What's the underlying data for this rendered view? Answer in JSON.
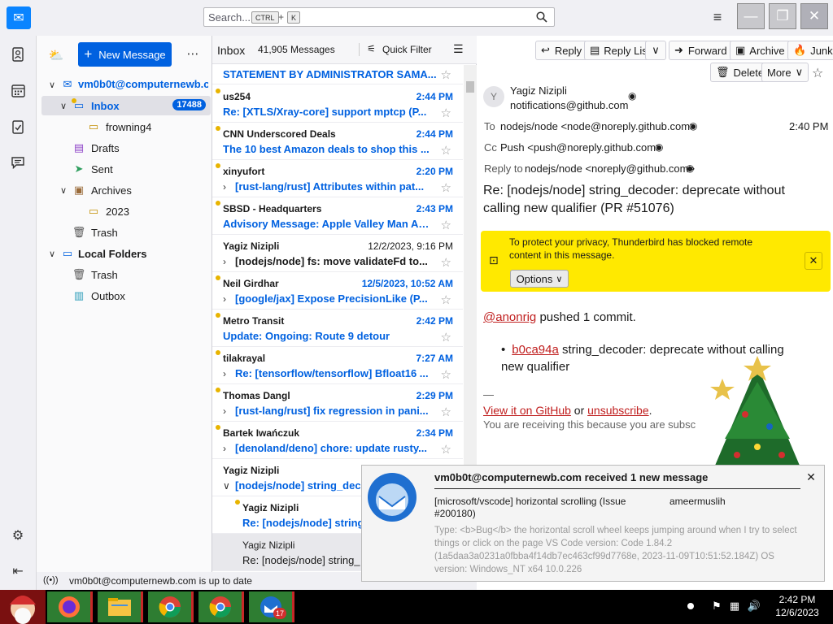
{
  "titlebar": {
    "search_placeholder": "Search...",
    "search_shortcut_ctrl": "CTRL",
    "search_shortcut_plus": "+",
    "search_shortcut_key": "K"
  },
  "folders": {
    "new_message": "New Message",
    "account": "vm0b0t@computernewb.com",
    "inbox": "Inbox",
    "inbox_count": "17488",
    "frowning": "frowning4",
    "drafts": "Drafts",
    "sent": "Sent",
    "archives": "Archives",
    "archives_2023": "2023",
    "trash": "Trash",
    "local_folders": "Local Folders",
    "local_trash": "Trash",
    "outbox": "Outbox"
  },
  "status": {
    "text": "vm0b0t@computernewb.com is up to date"
  },
  "thread": {
    "folder_name": "Inbox",
    "count": "41,905 Messages",
    "quick_filter": "Quick Filter",
    "pinned_subject": "STATEMENT BY ADMINISTRATOR SAMA...",
    "messages": [
      {
        "sender": "us254",
        "date": "2:44 PM",
        "subject": "Re: [XTLS/Xray-core] support mptcp (P..."
      },
      {
        "sender": "CNN Underscored Deals",
        "date": "2:44 PM",
        "subject": "The 10 best Amazon deals to shop this ..."
      },
      {
        "sender": "xinyufort",
        "date": "2:20 PM",
        "subject": "[rust-lang/rust] Attributes within pat..."
      },
      {
        "sender": "SBSD - Headquarters",
        "date": "2:43 PM",
        "subject": "Advisory Message: Apple Valley Man Ar..."
      },
      {
        "sender": "Yagiz Nizipli",
        "date": "12/2/2023, 9:16 PM",
        "subject": "[nodejs/node] fs: move validateFd to..."
      },
      {
        "sender": "Neil Girdhar",
        "date": "12/5/2023, 10:52 AM",
        "subject": "[google/jax] Expose PrecisionLike (P..."
      },
      {
        "sender": "Metro Transit",
        "date": "2:42 PM",
        "subject": "Update: Ongoing: Route 9 detour"
      },
      {
        "sender": "tilakrayal",
        "date": "7:27 AM",
        "subject": "Re: [tensorflow/tensorflow] Bfloat16 ..."
      },
      {
        "sender": "Thomas Dangl",
        "date": "2:29 PM",
        "subject": "[rust-lang/rust] fix regression in pani..."
      },
      {
        "sender": "Bartek Iwańczuk",
        "date": "2:34 PM",
        "subject": "[denoland/deno] chore: update rusty..."
      },
      {
        "sender": "Yagiz Nizipli",
        "date": "",
        "subject": "[nodejs/node] string_dec"
      },
      {
        "sender": "Yagiz Nizipli",
        "date": "",
        "subject": "Re: [nodejs/node] string"
      },
      {
        "sender": "Yagiz Nizipli",
        "date": "",
        "subject": "Re: [nodejs/node] string_"
      }
    ]
  },
  "toolbar": {
    "reply": "Reply",
    "reply_list": "Reply List",
    "forward": "Forward",
    "archive": "Archive",
    "junk": "Junk",
    "delete": "Delete",
    "more": "More"
  },
  "message": {
    "from_name": "Yagiz Nizipli",
    "from_email": "notifications@github.com",
    "avatar_letter": "Y",
    "to_label": "To",
    "to_value": "nodejs/node <node@noreply.github.com>",
    "time": "2:40 PM",
    "cc_label": "Cc",
    "cc_value": "Push <push@noreply.github.com>",
    "replyto_label": "Reply to",
    "replyto_value": "nodejs/node <noreply@github.com>",
    "subject": "Re: [nodejs/node] string_decoder: deprecate without calling new qualifier (PR #51076)",
    "privacy_text": "To protect your privacy, Thunderbird has blocked remote content in this message.",
    "options": "Options",
    "body_user": "@anonrig",
    "body_pushed": "pushed 1 commit.",
    "commit_hash": "b0ca94a",
    "commit_msg": "string_decoder: deprecate without calling new qualifier",
    "dash": "—",
    "view_github": "View it on GitHub",
    "or": "or",
    "unsubscribe": "unsubscribe",
    "period": ".",
    "receiving": "You are receiving this because you are subsc"
  },
  "notification": {
    "title": "vm0b0t@computernewb.com received 1 new message",
    "subject": "[microsoft/vscode] horizontal scrolling (Issue #200180)",
    "author": "ameermuslih",
    "preview": "Type: <b>Bug</b> the horizontal scroll wheel keeps jumping around when I try to select things or click on the page VS Code version: Code 1.84.2 (1a5daa3a0231a0fbba4f14db7ec463cf99d7768e, 2023-11-09T10:51:52.184Z) OS version: Windows_NT x64 10.0.226"
  },
  "taskbar": {
    "time": "2:42 PM",
    "date": "12/6/2023",
    "tb_badge": "17"
  },
  "colors": {
    "accent": "#0061e0",
    "unread_dot": "#e8b400",
    "privacy_bar": "#ffe900",
    "link_red": "#c01e1e"
  }
}
